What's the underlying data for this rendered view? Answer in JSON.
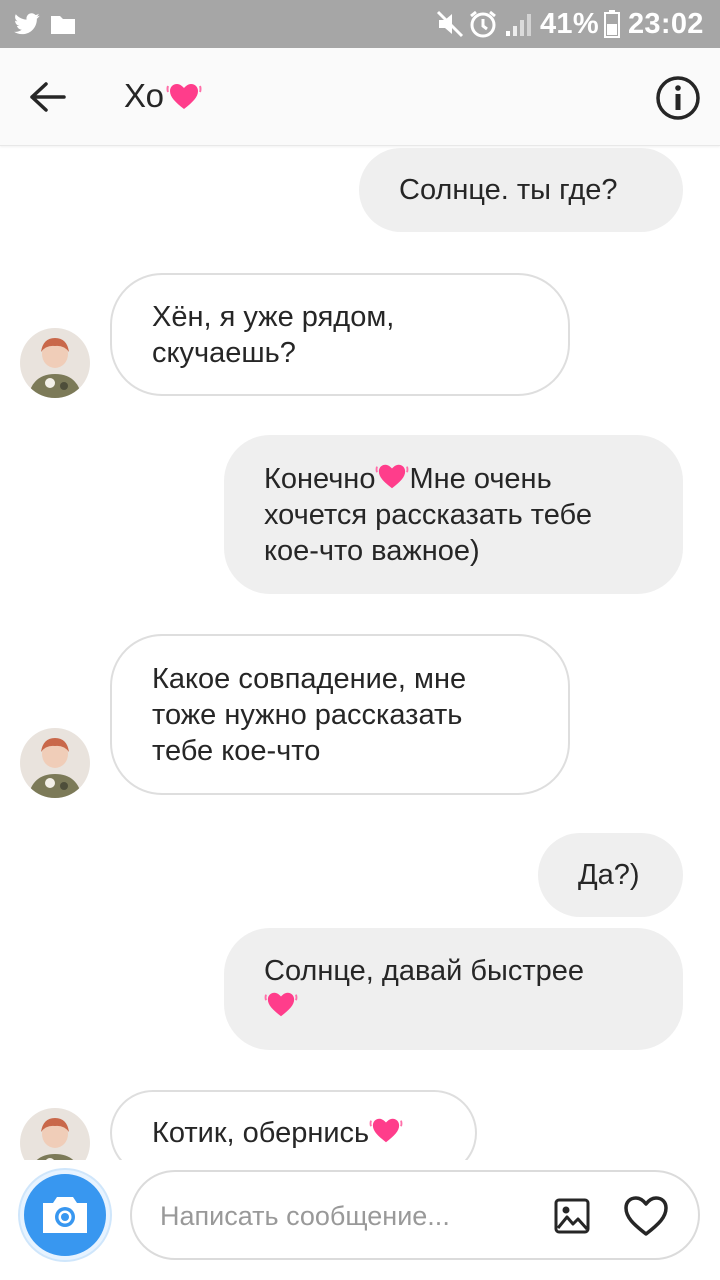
{
  "status_bar": {
    "battery": "41%",
    "time": "23:02",
    "icons": [
      "twitter-icon",
      "folder-icon",
      "mute-icon",
      "alarm-icon",
      "signal-icon",
      "battery-icon"
    ]
  },
  "header": {
    "title": "Хо",
    "title_emoji": "heart-icon",
    "back_icon": "arrow-left-icon",
    "info_icon": "info-icon"
  },
  "messages": [
    {
      "from": "me",
      "text": "Солнце. ты где?"
    },
    {
      "from": "them",
      "text": "Хён, я уже рядом, скучаешь?"
    },
    {
      "from": "me",
      "text_before": "Конечно",
      "text_after": "Мне очень хочется рассказать тебе кое-что важное)"
    },
    {
      "from": "them",
      "text": "Какое совпадение, мне тоже нужно рассказать тебе кое-что"
    },
    {
      "from": "me",
      "text": "Да?)"
    },
    {
      "from": "me",
      "text": "Солнце, давай быстрее"
    },
    {
      "from": "them",
      "text": "Котик, обернись"
    }
  ],
  "composer": {
    "placeholder": "Написать сообщение...",
    "camera_icon": "camera-icon",
    "gallery_icon": "image-icon",
    "like_icon": "heart-outline-icon"
  },
  "colors": {
    "status_bar": "#a6a6a6",
    "header_bg": "#fafafa",
    "outgoing_bubble": "#efefef",
    "incoming_border": "#dedede",
    "camera_button": "#3897f0",
    "heart_emoji": "#ff3d8b"
  }
}
